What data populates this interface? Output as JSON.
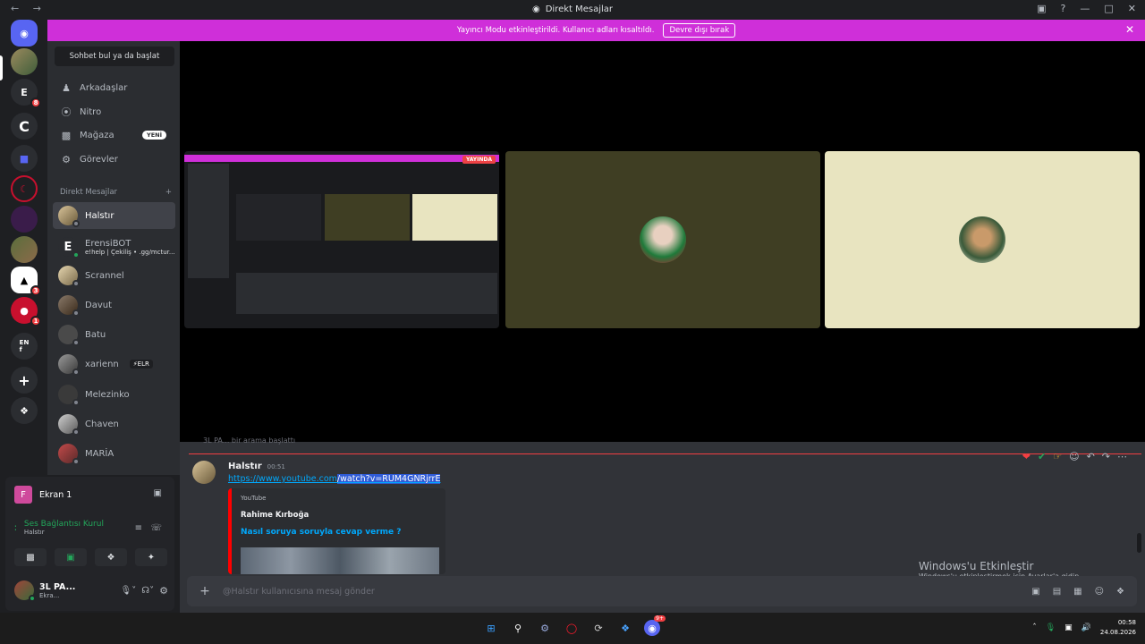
{
  "window": {
    "title": "Direkt Mesajlar",
    "nav_arrows": "← →"
  },
  "banner": {
    "text": "Yayıncı Modu etkinleştirildi. Kullanıcı adları kısaltıldı.",
    "button": "Devre dışı bırak",
    "accent": "#cf2fd9"
  },
  "rail": {
    "badges": [
      "8",
      "3",
      "1"
    ]
  },
  "sidebar": {
    "search": "Sohbet bul ya da başlat",
    "nav": [
      {
        "label": "Arkadaşlar",
        "icon": "friends-icon"
      },
      {
        "label": "Nitro",
        "icon": "nitro-icon"
      },
      {
        "label": "Mağaza",
        "icon": "shop-icon",
        "badge": "YENİ"
      },
      {
        "label": "Görevler",
        "icon": "quests-icon"
      }
    ],
    "dm_header": "Direkt Mesajlar",
    "dm_add": "+",
    "dms": [
      {
        "name": "Halstır"
      },
      {
        "name": "ErensiBOT",
        "sub": "e!help | Çekiliş • .gg/mctur..."
      },
      {
        "name": "Scrannel"
      },
      {
        "name": "Davut"
      },
      {
        "name": "Batu"
      },
      {
        "name": "xarienn",
        "tag": "⚡ELR"
      },
      {
        "name": "Melezinko"
      },
      {
        "name": "Chaven"
      },
      {
        "name": "MARİA"
      }
    ]
  },
  "panel": {
    "stream": "Ekran 1",
    "stream_initial": "F",
    "voice_status": "Ses Bağlantısı Kurul",
    "voice_channel": "Halstır",
    "user_name": "3L PA...",
    "user_status": "Ekra..."
  },
  "stage": {
    "live_badge": "YAYINDA"
  },
  "chat": {
    "prev_line": "3L PA... bir arama başlattı",
    "author": "Halstır",
    "time": "00:51",
    "link_plain": "https://www.youtube.com",
    "link_selected": "/watch?v=RUM4GNRjrrE",
    "embed": {
      "provider": "YouTube",
      "author": "Rahime Kırboğa",
      "title": "Nasıl soruya soruyla cevap verme ?"
    },
    "composer_placeholder": "@Halstır kullanıcısına mesaj gönder",
    "activate_title": "Windows'u Etkinleştir",
    "activate_sub": "Windows'u etkinleştirmek için Ayarlar'a gidin."
  },
  "taskbar": {
    "time": "00:58",
    "date": "24.08.2026",
    "discord_badge": "9+"
  }
}
